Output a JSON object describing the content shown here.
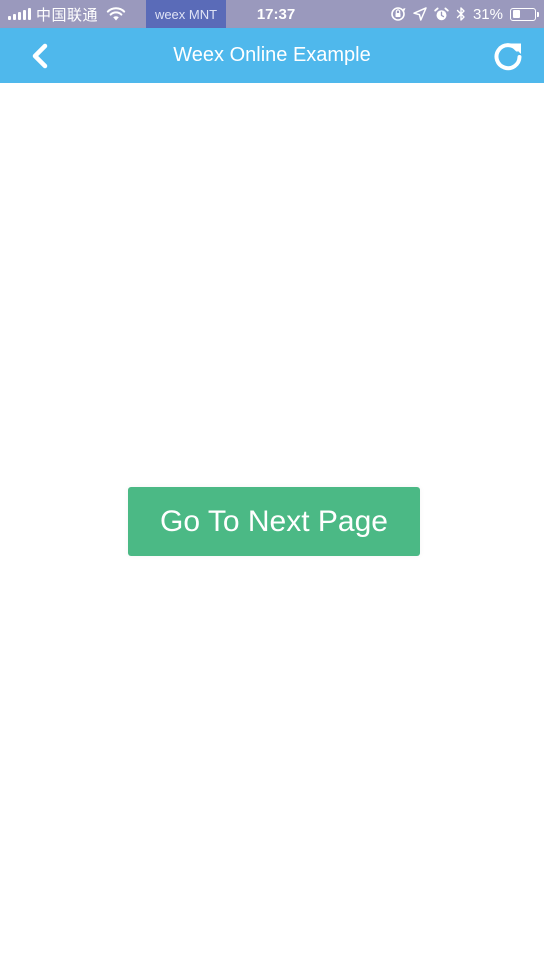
{
  "status_bar": {
    "carrier": "中国联通",
    "app_badge": "weex MNT",
    "time": "17:37",
    "battery_percent": "31%",
    "battery_level": 0.31,
    "icons": [
      "signal-icon",
      "wifi-icon",
      "orientation-lock-icon",
      "location-icon",
      "alarm-icon",
      "bluetooth-icon",
      "battery-icon"
    ]
  },
  "nav": {
    "title": "Weex Online Example",
    "back_icon": "chevron-left-icon",
    "refresh_icon": "refresh-icon"
  },
  "main": {
    "button_label": "Go To Next Page"
  },
  "colors": {
    "status_bar": "#9a99bd",
    "app_badge": "#5a6bb8",
    "nav_bar": "#4fb8ec",
    "button": "#4bb985",
    "background": "#ffffff"
  }
}
